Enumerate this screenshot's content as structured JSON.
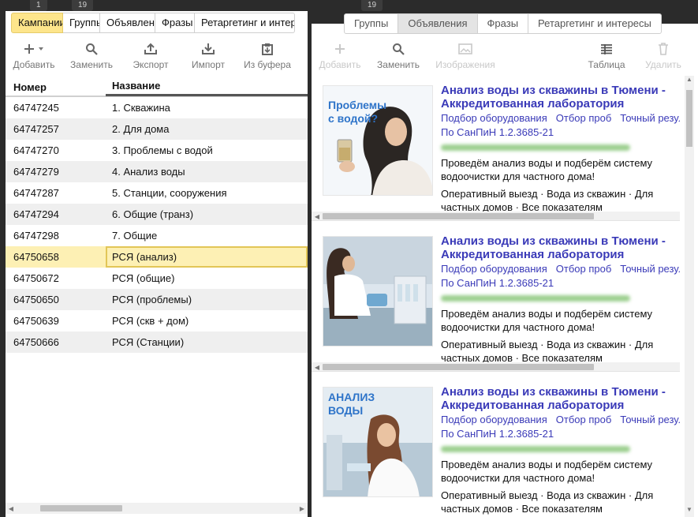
{
  "counters": {
    "left": "1",
    "middle": "19",
    "right": "19"
  },
  "left_tabs": [
    {
      "label": "Кампании",
      "active": true
    },
    {
      "label": "Группы",
      "active": false
    },
    {
      "label": "Объявления",
      "active": false
    },
    {
      "label": "Фразы",
      "active": false
    },
    {
      "label": "Ретаргетинг и интересы",
      "active": false
    }
  ],
  "left_toolbar": {
    "add": "Добавить",
    "replace": "Заменить",
    "export": "Экспорт",
    "import": "Импорт",
    "from_buffer": "Из буфера"
  },
  "grid": {
    "col_number": "Номер",
    "col_name": "Название",
    "rows": [
      {
        "number": "64747245",
        "name": "1. Скважина"
      },
      {
        "number": "64747257",
        "name": "2. Для дома"
      },
      {
        "number": "64747270",
        "name": "3. Проблемы с водой"
      },
      {
        "number": "64747279",
        "name": "4. Анализ воды"
      },
      {
        "number": "64747287",
        "name": "5. Станции, сооружения"
      },
      {
        "number": "64747294",
        "name": "6. Общие (транз)"
      },
      {
        "number": "64747298",
        "name": "7. Общие"
      },
      {
        "number": "64750658",
        "name": "РСЯ (анализ)",
        "selected": true
      },
      {
        "number": "64750672",
        "name": "РСЯ (общие)"
      },
      {
        "number": "64750650",
        "name": "РСЯ (проблемы)"
      },
      {
        "number": "64750639",
        "name": "РСЯ (скв + дом)"
      },
      {
        "number": "64750666",
        "name": "РСЯ (Станции)"
      }
    ]
  },
  "right_tabs": [
    {
      "label": "Группы",
      "active": false
    },
    {
      "label": "Объявления",
      "active": true
    },
    {
      "label": "Фразы",
      "active": false
    },
    {
      "label": "Ретаргетинг и интересы",
      "active": false
    }
  ],
  "right_toolbar": {
    "add": "Добавить",
    "replace": "Заменить",
    "images": "Изображения",
    "table": "Таблица",
    "delete": "Удалить"
  },
  "ads": [
    {
      "image_caption": "Проблемы\nс водой?",
      "title": "Анализ воды из скважины в Тюмени - Аккредитованная лаборатория",
      "links": [
        "Подбор оборудования",
        "Отбор проб",
        "Точный результат"
      ],
      "links_line2": "По СанПиН 1.2.3685-21",
      "desc": "Проведём анализ воды и подберём систему водоочистки для частного дома!",
      "extra": "Оперативный выезд · Вода из скважин · Для частных домов · Все показателям"
    },
    {
      "image_caption": "",
      "title": "Анализ воды из скважины в Тюмени - Аккредитованная лаборатория",
      "links": [
        "Подбор оборудования",
        "Отбор проб",
        "Точный результат"
      ],
      "links_line2": "По СанПиН 1.2.3685-21",
      "desc": "Проведём анализ воды и подберём систему водоочистки для частного дома!",
      "extra": "Оперативный выезд · Вода из скважин · Для частных домов · Все показателям"
    },
    {
      "image_caption": "АНАЛИЗ\nВОДЫ",
      "title": "Анализ воды из скважины в Тюмени - Аккредитованная лаборатория",
      "links": [
        "Подбор оборудования",
        "Отбор проб",
        "Точный результат"
      ],
      "links_line2": "По СанПиН 1.2.3685-21",
      "desc": "Проведём анализ воды и подберём систему водоочистки для частного дома!",
      "extra": "Оперативный выезд · Вода из скважин · Для частных домов · Все показателям"
    }
  ],
  "colors": {
    "active_tab": "#fde58b",
    "selected_row": "#fdf0b4",
    "link": "#3a3ab8",
    "url_blur": "#9ccf8f"
  }
}
